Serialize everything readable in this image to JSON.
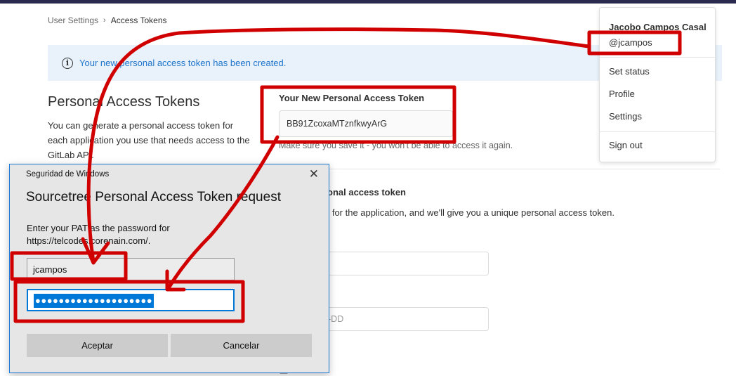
{
  "breadcrumb": {
    "parent": "User Settings",
    "separator": "›",
    "current": "Access Tokens"
  },
  "alert": {
    "icon": "info-icon",
    "text": "Your new personal access token has been created."
  },
  "page": {
    "title": "Personal Access Tokens",
    "description": "You can generate a personal access token for each application you use that needs access to the GitLab API."
  },
  "new_token": {
    "label": "Your New Personal Access Token",
    "value": "BB91ZcoxaMTznfkwyArG",
    "hint": "Make sure you save it - you won't be able to access it again."
  },
  "add_token": {
    "heading": "onal access token",
    "description": "e for the application, and we'll give you a unique personal access token.",
    "date_placeholder": "-DD"
  },
  "user_menu": {
    "name": "Jacobo Campos Casal",
    "username": "@jcampos",
    "items": [
      "Set status",
      "Profile",
      "Settings"
    ],
    "sign_out": "Sign out"
  },
  "dialog": {
    "caption": "Seguridad de Windows",
    "close": "✕",
    "heading": "Sourcetree Personal Access Token request",
    "prompt": "Enter your PAT as the password for https://telcodes.corenain.com/.",
    "username_value": "jcampos",
    "password_mask": "●●●●●●●●●●●●●●●●●●●●",
    "ok_label": "Aceptar",
    "cancel_label": "Cancelar"
  },
  "colors": {
    "annotation_red": "#d00000",
    "link_blue": "#1f75cb",
    "windows_blue": "#0078d7",
    "topbar": "#2a2a4e"
  }
}
